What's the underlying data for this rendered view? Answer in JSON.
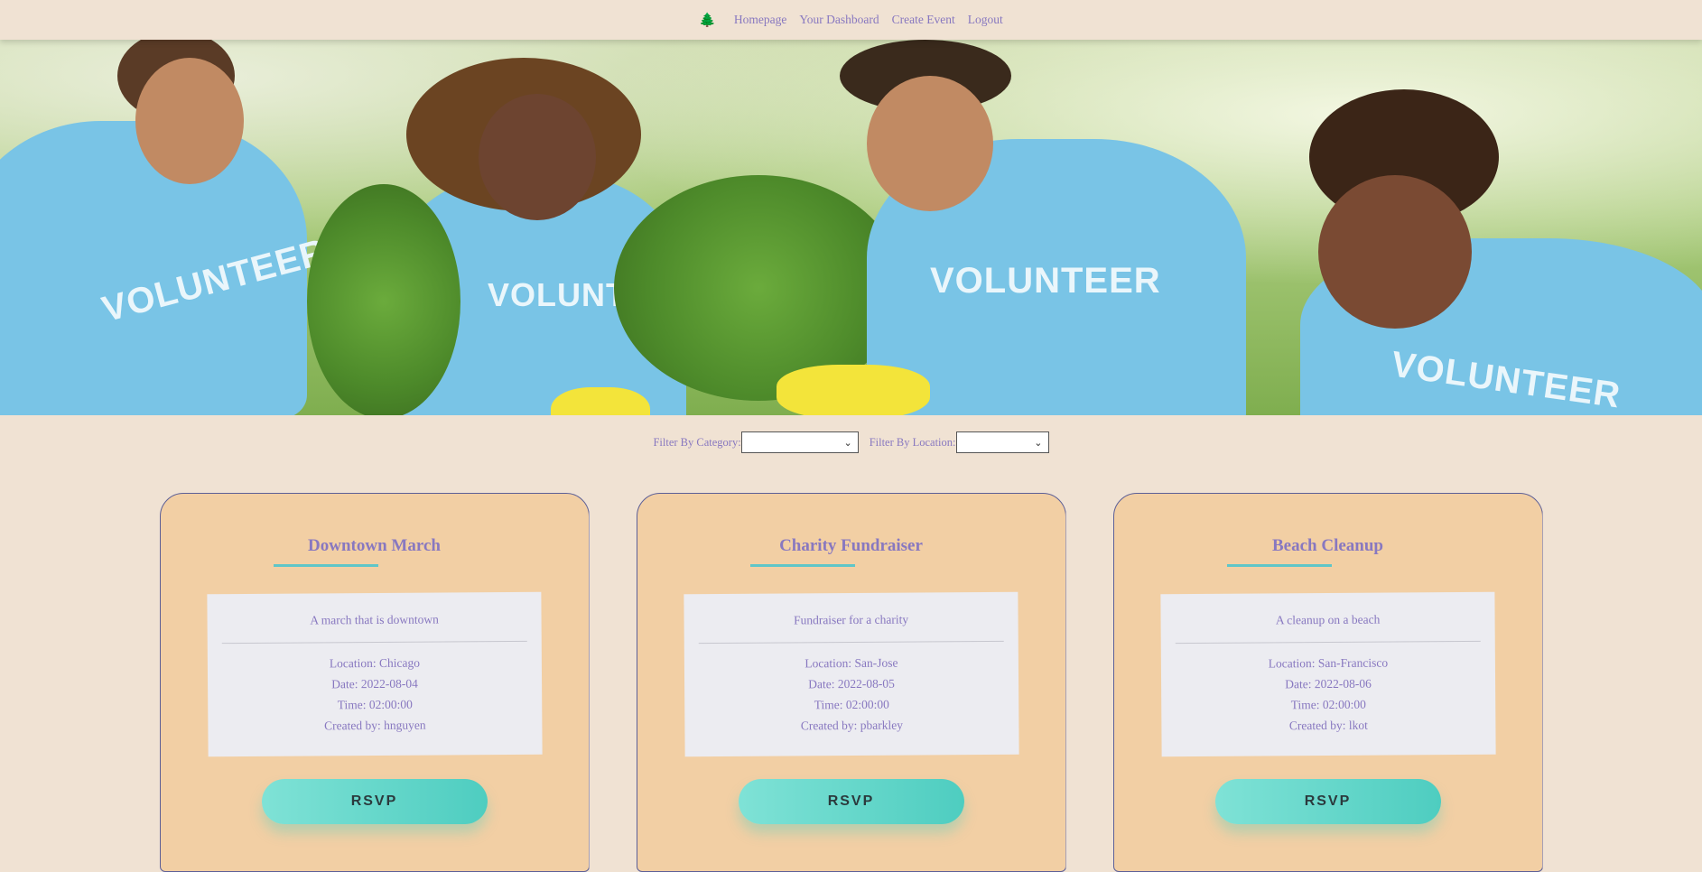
{
  "nav": {
    "logo_icon": "tree-icon",
    "links": [
      "Homepage",
      "Your Dashboard",
      "Create Event",
      "Logout"
    ]
  },
  "hero": {
    "shirt_texts": [
      "VOLUNTEER",
      "VOLUNTEER",
      "VOLUNTEER",
      "VOLUNTEER"
    ]
  },
  "filters": {
    "category_label": "Filter By Category:",
    "location_label": "Filter By Location:",
    "category_value": "",
    "location_value": ""
  },
  "events": [
    {
      "title": "Downtown March",
      "description": "A march that is downtown",
      "location": "Location: Chicago",
      "date": "Date: 2022-08-04",
      "time": "Time: 02:00:00",
      "created_by": "Created by: hnguyen",
      "button": "RSVP"
    },
    {
      "title": "Charity Fundraiser",
      "description": "Fundraiser for a charity",
      "location": "Location: San-Jose",
      "date": "Date: 2022-08-05",
      "time": "Time: 02:00:00",
      "created_by": "Created by: pbarkley",
      "button": "RSVP"
    },
    {
      "title": "Beach Cleanup",
      "description": "A cleanup on a beach",
      "location": "Location: San-Francisco",
      "date": "Date: 2022-08-06",
      "time": "Time: 02:00:00",
      "created_by": "Created by: lkot",
      "button": "RSVP"
    }
  ],
  "colors": {
    "background": "#f0e2d3",
    "card": "#f2cfa4",
    "accent_text": "#8878c0",
    "rsvp": "#4ecdc0"
  }
}
